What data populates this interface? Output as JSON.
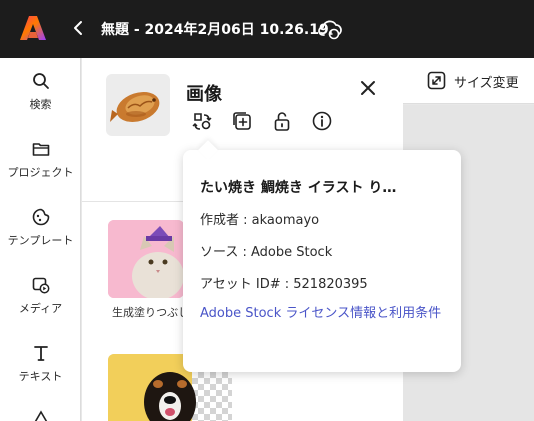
{
  "topbar": {
    "title": "無題 - 2024年2月06日 10.26.19"
  },
  "rail": {
    "items": [
      {
        "label": "検索",
        "icon": "search-icon"
      },
      {
        "label": "プロジェクト",
        "icon": "folder-icon"
      },
      {
        "label": "テンプレート",
        "icon": "template-icon"
      },
      {
        "label": "メディア",
        "icon": "media-icon"
      },
      {
        "label": "テキスト",
        "icon": "text-icon"
      },
      {
        "label": "",
        "icon": "shapes-icon"
      }
    ]
  },
  "panel": {
    "title": "画像",
    "tools": [
      "replace-icon",
      "add-icon",
      "unlock-icon",
      "info-icon"
    ],
    "gen_card_label": "生成塗りつぶし"
  },
  "right": {
    "resize_label": "サイズ変更"
  },
  "popover": {
    "title": "たい焼き 鯛焼き イラスト り…",
    "author": "作成者 : akaomayo",
    "source": "ソース : Adobe Stock",
    "asset_id": "アセット ID# : 521820395",
    "link": "Adobe Stock ライセンス情報と利用条件"
  },
  "colors": {
    "topbar_bg": "#1c1c1c",
    "link": "#4a55c8",
    "accent_pink": "#f7b9cf",
    "accent_yellow": "#f2cf5a"
  }
}
